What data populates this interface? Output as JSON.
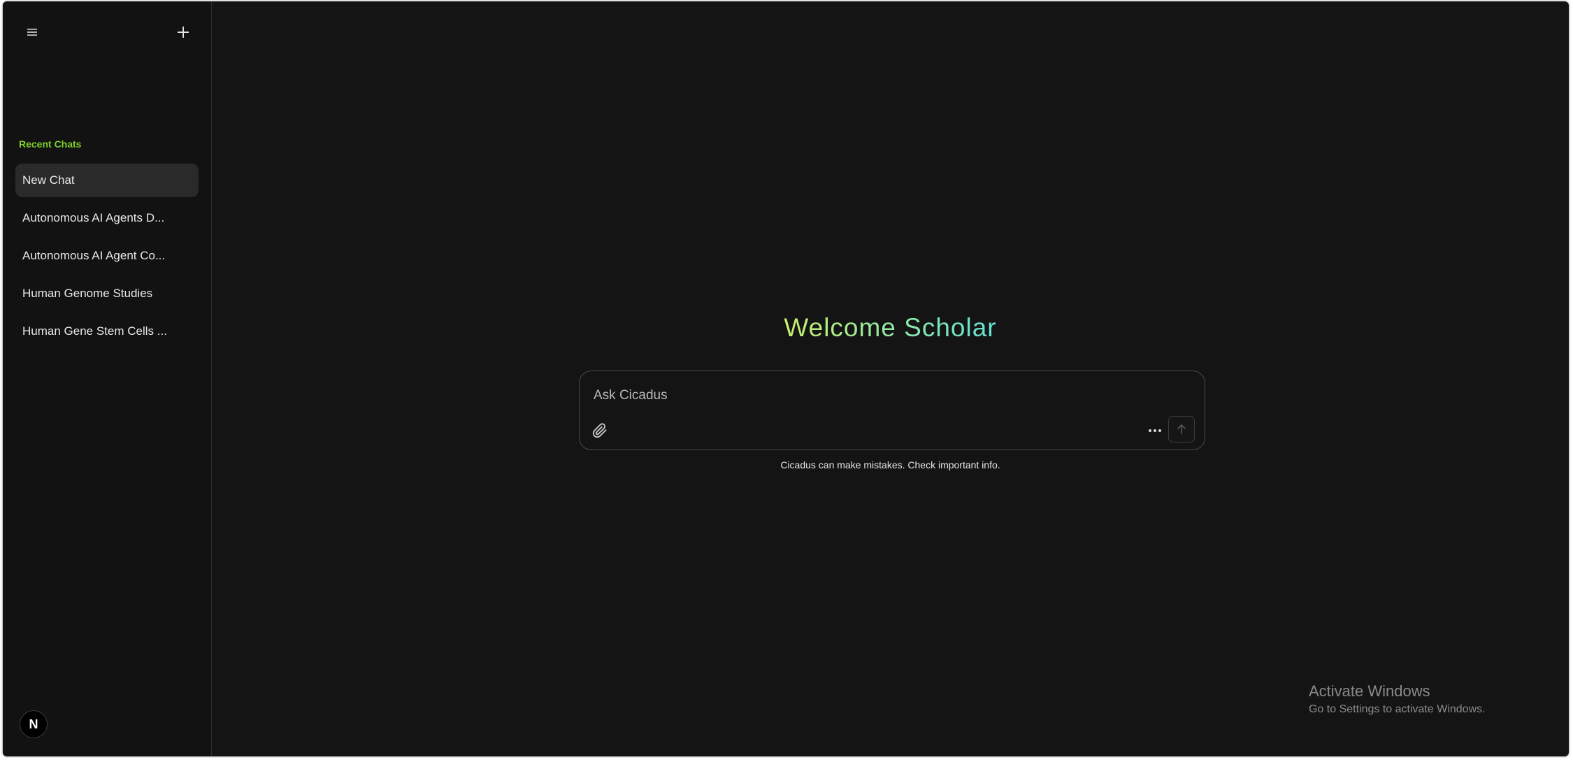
{
  "sidebar": {
    "section_label": "Recent Chats",
    "chats": [
      {
        "label": "New Chat",
        "active": true
      },
      {
        "label": "Autonomous AI Agents D..."
      },
      {
        "label": "Autonomous AI Agent Co..."
      },
      {
        "label": "Human Genome Studies"
      },
      {
        "label": "Human Gene Stem Cells ..."
      }
    ],
    "avatar_letter": "N",
    "icons": {
      "menu": "menu-icon",
      "new": "plus-icon"
    }
  },
  "main": {
    "welcome_title": "Welcome Scholar",
    "composer": {
      "placeholder": "Ask Cicadus",
      "value": "",
      "icons": {
        "attach": "paperclip-icon",
        "more": "ellipsis-icon",
        "send": "arrow-up-icon"
      }
    },
    "disclaimer": "Cicadus can make mistakes. Check important info."
  },
  "watermark": {
    "title": "Activate Windows",
    "subtitle": "Go to Settings to activate Windows."
  },
  "colors": {
    "background": "#141414",
    "accent_green": "#7fcf2c",
    "gradient_start": "#c8ef6e",
    "gradient_end": "#63e1d6"
  }
}
